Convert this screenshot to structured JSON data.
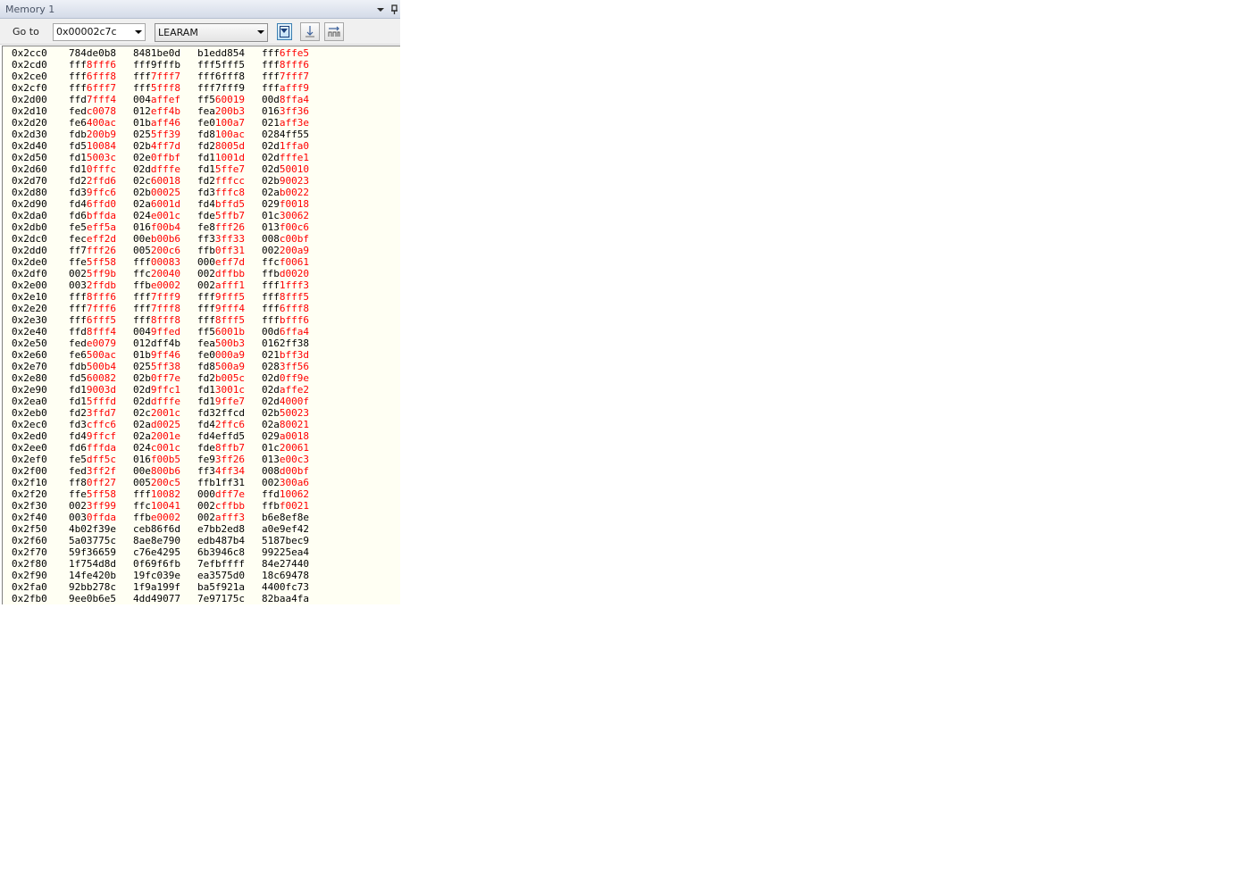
{
  "window": {
    "title": "Memory 1"
  },
  "toolbar": {
    "goto_label": "Go to",
    "address_value": "0x00002c7c",
    "memory_space": "LEARAM"
  },
  "icons": {
    "dropdown": "chevron-down-icon",
    "pin": "pin-icon",
    "format": "format-icon",
    "auto_refresh": "auto-refresh-icon",
    "columns": "columns-icon"
  },
  "colors": {
    "changed_value": "#ff0000",
    "background": "#fffff3"
  },
  "memory": {
    "rows": [
      {
        "address": "0x2cc0",
        "words": [
          "784de0b8",
          "8481be0d",
          "b1edd854",
          "fff6ffe5"
        ]
      },
      {
        "address": "0x2cd0",
        "words": [
          "fff8fff6",
          "fff9fffb",
          "fff5fff5",
          "fff8fff6"
        ]
      },
      {
        "address": "0x2ce0",
        "words": [
          "fff6fff8",
          "fff7fff7",
          "fff6fff8",
          "fff7fff7"
        ]
      },
      {
        "address": "0x2cf0",
        "words": [
          "fff6fff7",
          "fff5fff8",
          "fff7fff9",
          "fffafff9"
        ]
      },
      {
        "address": "0x2d00",
        "words": [
          "ffd7fff4",
          "004affef",
          "ff560019",
          "00d8ffa4"
        ]
      },
      {
        "address": "0x2d10",
        "words": [
          "fedc0078",
          "012eff4b",
          "fea200b3",
          "0163ff36"
        ]
      },
      {
        "address": "0x2d20",
        "words": [
          "fe6400ac",
          "01baff46",
          "fe0100a7",
          "021aff3e"
        ]
      },
      {
        "address": "0x2d30",
        "words": [
          "fdb200b9",
          "0255ff39",
          "fd8100ac",
          "0284ff55"
        ]
      },
      {
        "address": "0x2d40",
        "words": [
          "fd510084",
          "02b4ff7d",
          "fd28005d",
          "02d1ffa0"
        ]
      },
      {
        "address": "0x2d50",
        "words": [
          "fd15003c",
          "02e0ffbf",
          "fd11001d",
          "02dfffe1"
        ]
      },
      {
        "address": "0x2d60",
        "words": [
          "fd10fffc",
          "02ddfffe",
          "fd15ffe7",
          "02d50010"
        ]
      },
      {
        "address": "0x2d70",
        "words": [
          "fd22ffd6",
          "02c60018",
          "fd2fffcc",
          "02b90023"
        ]
      },
      {
        "address": "0x2d80",
        "words": [
          "fd39ffc6",
          "02b00025",
          "fd3fffc8",
          "02ab0022"
        ]
      },
      {
        "address": "0x2d90",
        "words": [
          "fd46ffd0",
          "02a6001d",
          "fd4bffd5",
          "029f0018"
        ]
      },
      {
        "address": "0x2da0",
        "words": [
          "fd6bffda",
          "024e001c",
          "fde5ffb7",
          "01c30062"
        ]
      },
      {
        "address": "0x2db0",
        "words": [
          "fe5eff5a",
          "016f00b4",
          "fe8fff26",
          "013f00c6"
        ]
      },
      {
        "address": "0x2dc0",
        "words": [
          "feceff2d",
          "00eb00b6",
          "ff33ff33",
          "008c00bf"
        ]
      },
      {
        "address": "0x2dd0",
        "words": [
          "ff7fff26",
          "005200c6",
          "ffb0ff31",
          "002200a9"
        ]
      },
      {
        "address": "0x2de0",
        "words": [
          "ffe5ff58",
          "fff00083",
          "000eff7d",
          "ffcf0061"
        ]
      },
      {
        "address": "0x2df0",
        "words": [
          "0025ff9b",
          "ffc20040",
          "002dffbb",
          "ffbd0020"
        ]
      },
      {
        "address": "0x2e00",
        "words": [
          "0032ffdb",
          "ffbe0002",
          "002afff1",
          "fff1fff3"
        ]
      },
      {
        "address": "0x2e10",
        "words": [
          "fff8fff6",
          "fff7fff9",
          "fff9fff5",
          "fff8fff5"
        ]
      },
      {
        "address": "0x2e20",
        "words": [
          "fff7fff6",
          "fff7fff8",
          "fff9fff4",
          "fff6fff8"
        ]
      },
      {
        "address": "0x2e30",
        "words": [
          "fff6fff5",
          "fff8fff8",
          "fff8fff5",
          "fffbfff6"
        ]
      },
      {
        "address": "0x2e40",
        "words": [
          "ffd8fff4",
          "0049ffed",
          "ff56001b",
          "00d6ffa4"
        ]
      },
      {
        "address": "0x2e50",
        "words": [
          "fede0079",
          "012dff4b",
          "fea500b3",
          "0162ff38"
        ]
      },
      {
        "address": "0x2e60",
        "words": [
          "fe6500ac",
          "01b9ff46",
          "fe0000a9",
          "021bff3d"
        ]
      },
      {
        "address": "0x2e70",
        "words": [
          "fdb500b4",
          "0255ff38",
          "fd8500a9",
          "0283ff56"
        ]
      },
      {
        "address": "0x2e80",
        "words": [
          "fd560082",
          "02b0ff7e",
          "fd2b005c",
          "02d0ff9e"
        ]
      },
      {
        "address": "0x2e90",
        "words": [
          "fd19003d",
          "02d9ffc1",
          "fd13001c",
          "02daffe2"
        ]
      },
      {
        "address": "0x2ea0",
        "words": [
          "fd15fffd",
          "02ddfffe",
          "fd19ffe7",
          "02d4000f"
        ]
      },
      {
        "address": "0x2eb0",
        "words": [
          "fd23ffd7",
          "02c2001c",
          "fd32ffcd",
          "02b50023"
        ]
      },
      {
        "address": "0x2ec0",
        "words": [
          "fd3cffc6",
          "02ad0025",
          "fd42ffc6",
          "02a80021"
        ]
      },
      {
        "address": "0x2ed0",
        "words": [
          "fd49ffcf",
          "02a2001e",
          "fd4effd5",
          "029a0018"
        ]
      },
      {
        "address": "0x2ee0",
        "words": [
          "fd6fffda",
          "024c001c",
          "fde8ffb7",
          "01c20061"
        ]
      },
      {
        "address": "0x2ef0",
        "words": [
          "fe5dff5c",
          "016f00b5",
          "fe93ff26",
          "013e00c3"
        ]
      },
      {
        "address": "0x2f00",
        "words": [
          "fed3ff2f",
          "00e800b6",
          "ff34ff34",
          "008d00bf"
        ]
      },
      {
        "address": "0x2f10",
        "words": [
          "ff80ff27",
          "005200c5",
          "ffb1ff31",
          "002300a6"
        ]
      },
      {
        "address": "0x2f20",
        "words": [
          "ffe5ff58",
          "fff10082",
          "000dff7e",
          "ffd10062"
        ]
      },
      {
        "address": "0x2f30",
        "words": [
          "0023ff99",
          "ffc10041",
          "002cffbb",
          "ffbf0021"
        ]
      },
      {
        "address": "0x2f40",
        "words": [
          "0030ffda",
          "ffbe0002",
          "002afff3",
          "b6e8ef8e"
        ]
      },
      {
        "address": "0x2f50",
        "words": [
          "4b02f39e",
          "ceb86f6d",
          "e7bb2ed8",
          "a0e9ef42"
        ]
      },
      {
        "address": "0x2f60",
        "words": [
          "5a03775c",
          "8ae8e790",
          "edb487b4",
          "5187bec9"
        ]
      },
      {
        "address": "0x2f70",
        "words": [
          "59f36659",
          "c76e4295",
          "6b3946c8",
          "99225ea4"
        ]
      },
      {
        "address": "0x2f80",
        "words": [
          "1f754d8d",
          "0f69f6fb",
          "7efbffff",
          "84e27440"
        ]
      },
      {
        "address": "0x2f90",
        "words": [
          "14fe420b",
          "19fc039e",
          "ea3575d0",
          "18c69478"
        ]
      },
      {
        "address": "0x2fa0",
        "words": [
          "92bb278c",
          "1f9a199f",
          "ba5f921a",
          "4400fc73"
        ]
      },
      {
        "address": "0x2fb0",
        "words": [
          "9ee0b6e5",
          "4dd49077",
          "7e97175c",
          "82baa4fa"
        ]
      }
    ],
    "changed_masks": [
      [
        "00000000",
        "00000000",
        "00000000",
        "00011111"
      ],
      [
        "00011111",
        "00000000",
        "00000000",
        "00011111"
      ],
      [
        "00011111",
        "00011111",
        "00000000",
        "00011111"
      ],
      [
        "00011111",
        "00011111",
        "00000000",
        "00011111"
      ],
      [
        "00011111",
        "00011111",
        "00011111",
        "00011111"
      ],
      [
        "00011111",
        "00011111",
        "00011111",
        "00011111"
      ],
      [
        "00011111",
        "00011111",
        "00011111",
        "00011111"
      ],
      [
        "00011111",
        "00011111",
        "00011111",
        "00000000"
      ],
      [
        "00011111",
        "00011111",
        "00011111",
        "00011111"
      ],
      [
        "00011111",
        "00011111",
        "00011111",
        "00011111"
      ],
      [
        "00011111",
        "00011111",
        "00011111",
        "00011111"
      ],
      [
        "00011111",
        "00011111",
        "00011111",
        "00011111"
      ],
      [
        "00011111",
        "00011111",
        "00011111",
        "00011111"
      ],
      [
        "00011111",
        "00011111",
        "00011111",
        "00011111"
      ],
      [
        "00011111",
        "00011111",
        "00011111",
        "00011111"
      ],
      [
        "00011111",
        "00011111",
        "00011111",
        "00011111"
      ],
      [
        "00011111",
        "00011111",
        "00011111",
        "00011111"
      ],
      [
        "00011111",
        "00011111",
        "00011111",
        "00011111"
      ],
      [
        "00011111",
        "00011111",
        "00011111",
        "00011111"
      ],
      [
        "00011111",
        "00011111",
        "00011111",
        "00011111"
      ],
      [
        "00011111",
        "00011111",
        "00011111",
        "00011111"
      ],
      [
        "00011111",
        "00011111",
        "00011111",
        "00011111"
      ],
      [
        "00011111",
        "00011111",
        "00011111",
        "00011111"
      ],
      [
        "00011111",
        "00011111",
        "00011111",
        "00011111"
      ],
      [
        "00011111",
        "00011111",
        "00011111",
        "00011111"
      ],
      [
        "00011111",
        "00000000",
        "00011111",
        "00000000"
      ],
      [
        "00011111",
        "00011111",
        "00011111",
        "00011111"
      ],
      [
        "00011111",
        "00011111",
        "00011111",
        "00011111"
      ],
      [
        "00011111",
        "00011111",
        "00011111",
        "00011111"
      ],
      [
        "00011111",
        "00011111",
        "00011111",
        "00011111"
      ],
      [
        "00011111",
        "00011111",
        "00011111",
        "00011111"
      ],
      [
        "00011111",
        "00011111",
        "00000000",
        "00011111"
      ],
      [
        "00011111",
        "00011111",
        "00011111",
        "00011111"
      ],
      [
        "00011111",
        "00011111",
        "00000000",
        "00011111"
      ],
      [
        "00011111",
        "00011111",
        "00011111",
        "00011111"
      ],
      [
        "00011111",
        "00011111",
        "00011111",
        "00011111"
      ],
      [
        "00011111",
        "00011111",
        "00011111",
        "00011111"
      ],
      [
        "00011111",
        "00011111",
        "00000000",
        "00011111"
      ],
      [
        "00011111",
        "00011111",
        "00011111",
        "00011111"
      ],
      [
        "00011111",
        "00011111",
        "00011111",
        "00011111"
      ],
      [
        "00011111",
        "00011111",
        "00011111",
        "00000000"
      ],
      [
        "00000000",
        "00000000",
        "00000000",
        "00000000"
      ],
      [
        "00000000",
        "00000000",
        "00000000",
        "00000000"
      ],
      [
        "00000000",
        "00000000",
        "00000000",
        "00000000"
      ],
      [
        "00000000",
        "00000000",
        "00000000",
        "00000000"
      ],
      [
        "00000000",
        "00000000",
        "00000000",
        "00000000"
      ],
      [
        "00000000",
        "00000000",
        "00000000",
        "00000000"
      ],
      [
        "00000000",
        "00000000",
        "00000000",
        "00000000"
      ]
    ]
  }
}
